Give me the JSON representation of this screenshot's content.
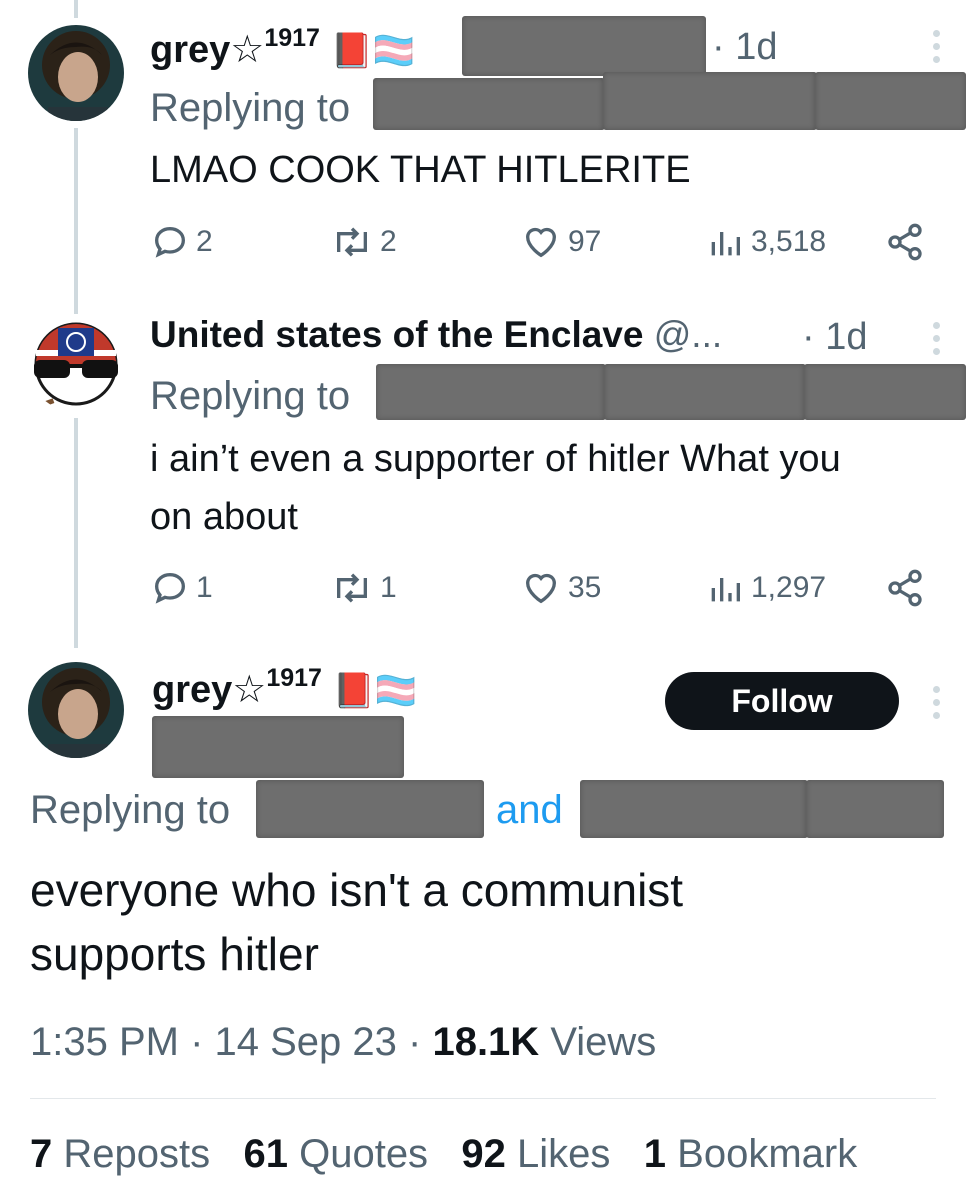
{
  "tweets": [
    {
      "display_name": "grey☆",
      "name_suffix": "1917",
      "badge_emojis": [
        "📕",
        "🏳️‍⚧️"
      ],
      "time": "· 1d",
      "replying_label": "Replying to",
      "text": "LMAO COOK THAT HITLERITE",
      "replies": "2",
      "reposts": "2",
      "likes": "97",
      "views": "3,518"
    },
    {
      "display_name": "United states of the Enclave",
      "handle": "@...",
      "time": "· 1d",
      "replying_label": "Replying to",
      "text_line1": "i ain’t even a supporter of hitler What you",
      "text_line2": "on about",
      "replies": "1",
      "reposts": "1",
      "likes": "35",
      "views": "1,297"
    }
  ],
  "main_tweet": {
    "display_name": "grey☆",
    "name_suffix": "1917",
    "badge_emojis": [
      "📕",
      "🏳️‍⚧️"
    ],
    "follow_label": "Follow",
    "replying_label": "Replying to",
    "and_label": "and",
    "text_line1": "everyone who isn't a communist",
    "text_line2": "supports hitler",
    "time": "1:35 PM",
    "date": "14 Sep 23",
    "views_count": "18.1K",
    "views_label": "Views",
    "stats": {
      "reposts_count": "7",
      "reposts_label": "Reposts",
      "quotes_count": "61",
      "quotes_label": "Quotes",
      "likes_count": "92",
      "likes_label": "Likes",
      "bookmarks_count": "1",
      "bookmarks_label": "Bookmark"
    }
  },
  "colors": {
    "text": "#0f1419",
    "secondary": "#536471",
    "link": "#1d9bf0",
    "thread_line": "#cfd9de",
    "follow_bg": "#0f1419"
  },
  "icons": [
    "reply-icon",
    "repost-icon",
    "like-icon",
    "views-icon",
    "share-icon",
    "more-icon"
  ]
}
